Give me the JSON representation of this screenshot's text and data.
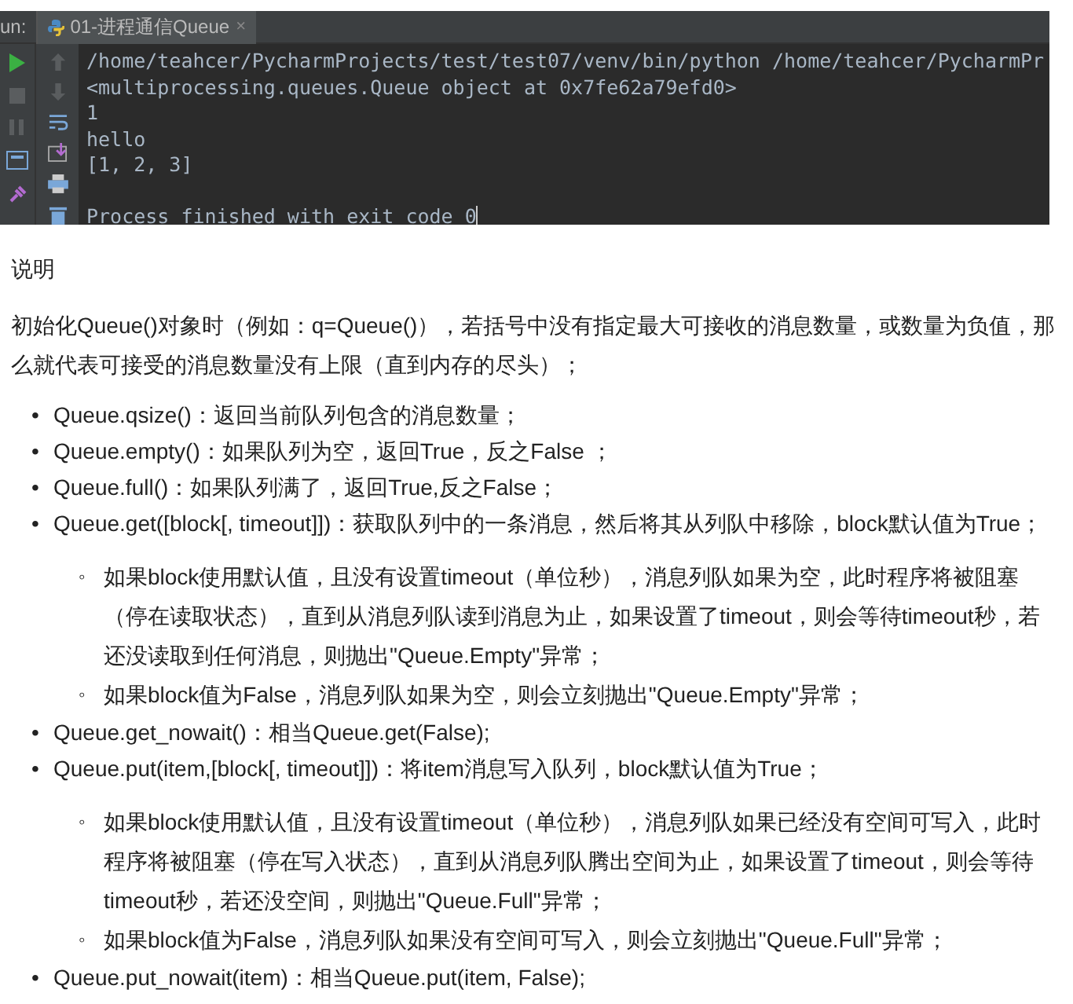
{
  "run_panel": {
    "label": "un:",
    "tab": {
      "title": "01-进程通信Queue",
      "close": "×"
    },
    "console_lines": [
      {
        "kind": "output",
        "text": "/home/teahcer/PycharmProjects/test/test07/venv/bin/python /home/teahcer/PycharmPr"
      },
      {
        "kind": "output",
        "text": "<multiprocessing.queues.Queue object at 0x7fe62a79efd0>"
      },
      {
        "kind": "output",
        "text": "1"
      },
      {
        "kind": "output",
        "text": "hello"
      },
      {
        "kind": "output",
        "text": "[1, 2, 3]"
      },
      {
        "kind": "exit",
        "text": "Process finished with exit code 0"
      }
    ]
  },
  "document": {
    "heading": "说明",
    "intro": "初始化Queue()对象时（例如：q=Queue()），若括号中没有指定最大可接收的消息数量，或数量为负值，那么就代表可接受的消息数量没有上限（直到内存的尽头）；",
    "bullet": "•",
    "sub_bullet": "◦",
    "items": [
      {
        "text": "Queue.qsize()：返回当前队列包含的消息数量；"
      },
      {
        "text": "Queue.empty()：如果队列为空，返回True，反之False ；"
      },
      {
        "text": "Queue.full()：如果队列满了，返回True,反之False；"
      },
      {
        "text": "Queue.get([block[, timeout]])：获取队列中的一条消息，然后将其从列队中移除，block默认值为True；",
        "children": [
          {
            "text": "如果block使用默认值，且没有设置timeout（单位秒），消息列队如果为空，此时程序将被阻塞（停在读取状态），直到从消息列队读到消息为止，如果设置了timeout，则会等待timeout秒，若还没读取到任何消息，则抛出\"Queue.Empty\"异常；"
          },
          {
            "text": "如果block值为False，消息列队如果为空，则会立刻抛出\"Queue.Empty\"异常；"
          }
        ]
      },
      {
        "text": "Queue.get_nowait()：相当Queue.get(False);"
      },
      {
        "text": "Queue.put(item,[block[, timeout]])：将item消息写入队列，block默认值为True；",
        "children": [
          {
            "text": "如果block使用默认值，且没有设置timeout（单位秒），消息列队如果已经没有空间可写入，此时程序将被阻塞（停在写入状态），直到从消息列队腾出空间为止，如果设置了timeout，则会等待timeout秒，若还没空间，则抛出\"Queue.Full\"异常；"
          },
          {
            "text": "如果block值为False，消息列队如果没有空间可写入，则会立刻抛出\"Queue.Full\"异常；"
          }
        ]
      },
      {
        "text": "Queue.put_nowait(item)：相当Queue.put(item, False);"
      }
    ]
  }
}
